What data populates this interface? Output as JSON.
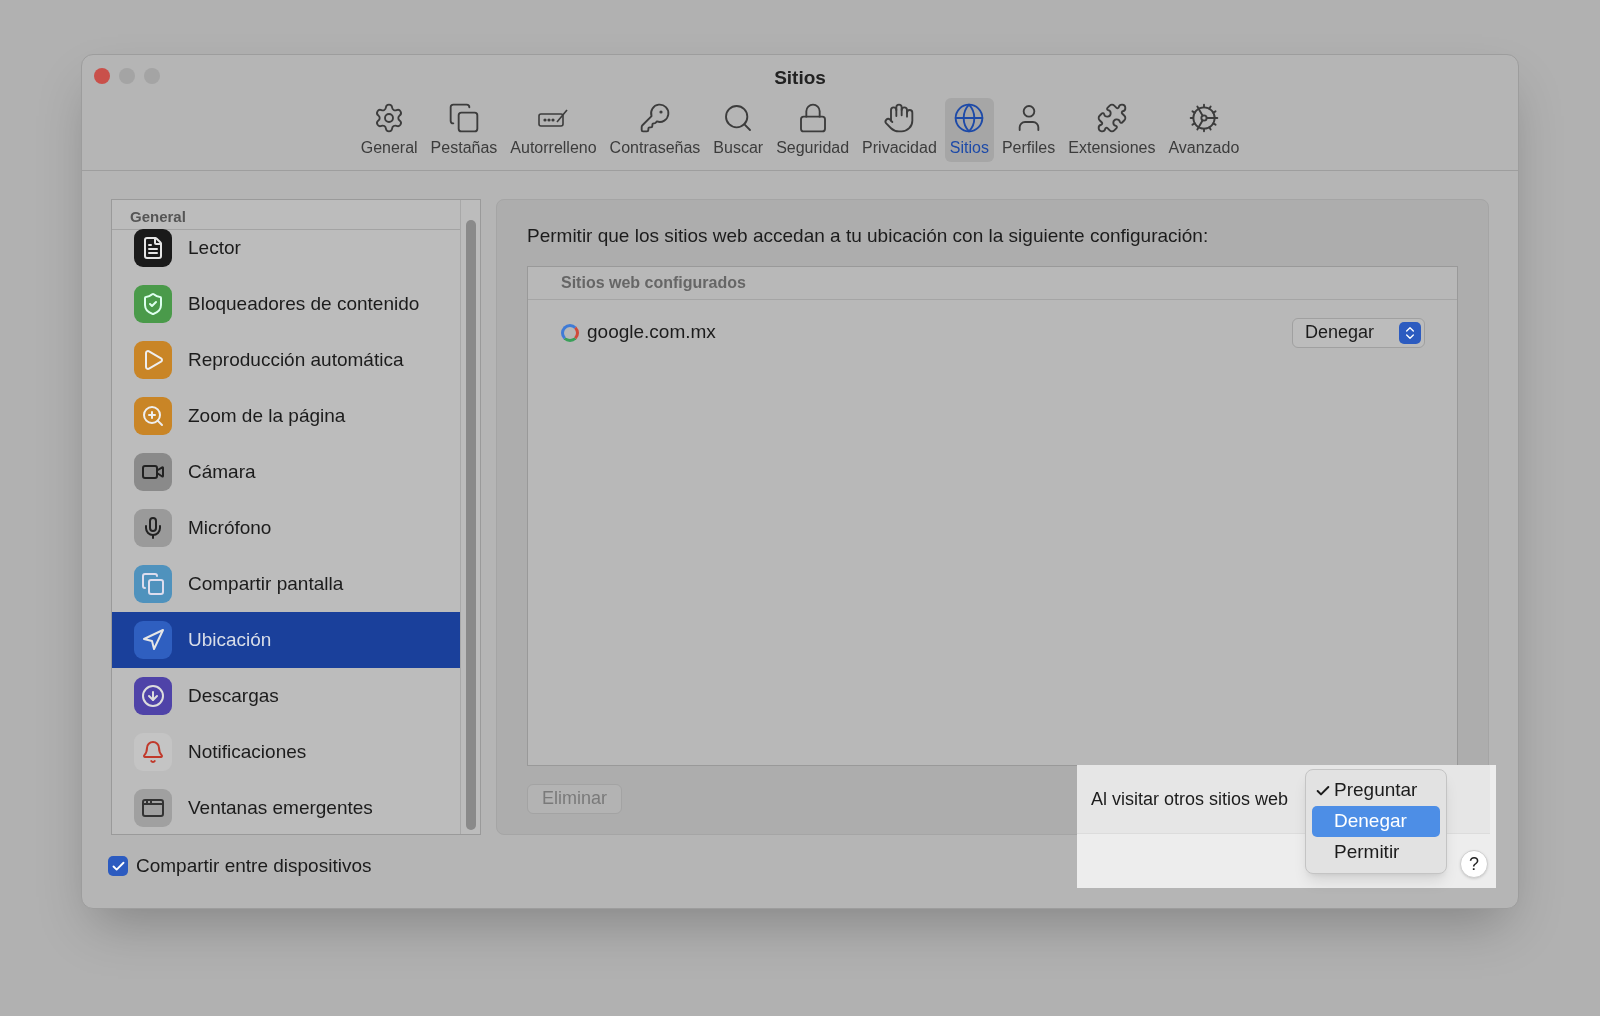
{
  "window": {
    "title": "Sitios"
  },
  "toolbar_tabs": [
    {
      "label": "General",
      "selected": false
    },
    {
      "label": "Pestañas",
      "selected": false
    },
    {
      "label": "Autorrelleno",
      "selected": false
    },
    {
      "label": "Contraseñas",
      "selected": false
    },
    {
      "label": "Buscar",
      "selected": false
    },
    {
      "label": "Seguridad",
      "selected": false
    },
    {
      "label": "Privacidad",
      "selected": false
    },
    {
      "label": "Sitios",
      "selected": true
    },
    {
      "label": "Perfiles",
      "selected": false
    },
    {
      "label": "Extensiones",
      "selected": false
    },
    {
      "label": "Avanzado",
      "selected": false
    }
  ],
  "sidebar": {
    "header": "General",
    "items": [
      {
        "label": "Lector",
        "selected": false
      },
      {
        "label": "Bloqueadores de contenido",
        "selected": false
      },
      {
        "label": "Reproducción automática",
        "selected": false
      },
      {
        "label": "Zoom de la página",
        "selected": false
      },
      {
        "label": "Cámara",
        "selected": false
      },
      {
        "label": "Micrófono",
        "selected": false
      },
      {
        "label": "Compartir pantalla",
        "selected": false
      },
      {
        "label": "Ubicación",
        "selected": true
      },
      {
        "label": "Descargas",
        "selected": false
      },
      {
        "label": "Notificaciones",
        "selected": false
      },
      {
        "label": "Ventanas emergentes",
        "selected": false
      }
    ]
  },
  "share_checkbox": {
    "label": "Compartir entre dispositivos",
    "checked": true
  },
  "panel": {
    "description": "Permitir que los sitios web accedan a tu ubicación con la siguiente configuración:",
    "table": {
      "header": "Sitios web configurados",
      "rows": [
        {
          "site": "google.com.mx",
          "setting": "Denegar"
        }
      ]
    },
    "delete_button": {
      "label": "Eliminar",
      "disabled": true
    }
  },
  "default_setting": {
    "label": "Al visitar otros sitios web",
    "menu": [
      {
        "label": "Preguntar",
        "checked": true,
        "selected": false
      },
      {
        "label": "Denegar",
        "checked": false,
        "selected": true
      },
      {
        "label": "Permitir",
        "checked": false,
        "selected": false
      }
    ]
  },
  "help_button": {
    "label": "?"
  }
}
